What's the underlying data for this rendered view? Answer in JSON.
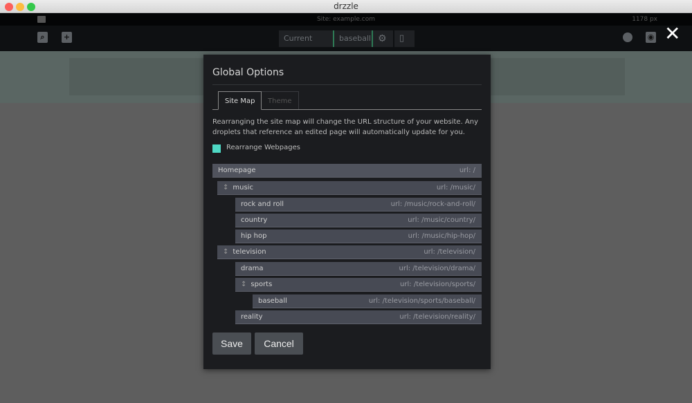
{
  "window": {
    "title": "drzzle"
  },
  "topbar": {
    "site": "Site: example.com",
    "width": "1178 px"
  },
  "toolbar": {
    "current_page_label": "Current Page:",
    "current_page": "baseball"
  },
  "modal": {
    "title": "Global Options",
    "tabs": [
      {
        "label": "Site Map",
        "active": true
      },
      {
        "label": "Theme",
        "active": false
      }
    ],
    "description": "Rearranging the site map will change the URL structure of your website. Any droplets that reference an edited page will automatically update for you.",
    "checkbox": {
      "label": "Rearrange Webpages",
      "checked": true,
      "color": "#4ed8c4"
    },
    "pages": [
      {
        "name": "Homepage",
        "url": "url: /",
        "level": 0,
        "drag": false
      },
      {
        "name": "music",
        "url": "url: /music/",
        "level": 1,
        "drag": true
      },
      {
        "name": "rock and roll",
        "url": "url: /music/rock-and-roll/",
        "level": 2,
        "drag": false
      },
      {
        "name": "country",
        "url": "url: /music/country/",
        "level": 2,
        "drag": false
      },
      {
        "name": "hip hop",
        "url": "url: /music/hip-hop/",
        "level": 2,
        "drag": false
      },
      {
        "name": "television",
        "url": "url: /television/",
        "level": 1,
        "drag": true
      },
      {
        "name": "drama",
        "url": "url: /television/drama/",
        "level": 2,
        "drag": false
      },
      {
        "name": "sports",
        "url": "url: /television/sports/",
        "level": 2,
        "drag": true
      },
      {
        "name": "baseball",
        "url": "url: /television/sports/baseball/",
        "level": 3,
        "drag": false
      },
      {
        "name": "reality",
        "url": "url: /television/reality/",
        "level": 2,
        "drag": false
      }
    ],
    "save_label": "Save",
    "cancel_label": "Cancel"
  }
}
